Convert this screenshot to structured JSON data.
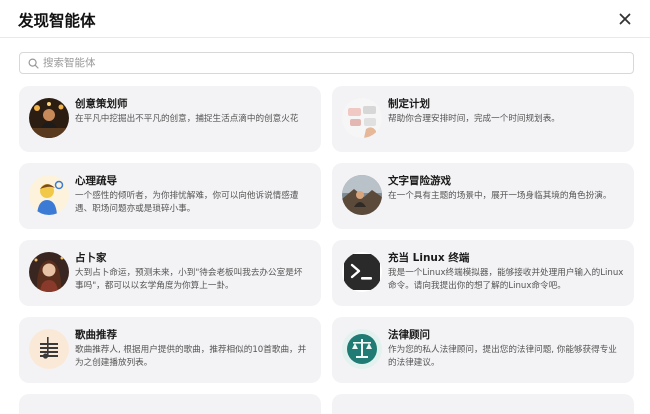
{
  "header": {
    "title": "发现智能体"
  },
  "search": {
    "placeholder": "搜索智能体"
  },
  "cards": [
    {
      "name": "创意策划师",
      "desc1": "在平凡中挖掘出不平凡的创意，捕捉生活点滴中的创意火花",
      "desc2": ""
    },
    {
      "name": "制定计划",
      "desc1": "帮助你合理安排时间，完成一个时间规划表。",
      "desc2": ""
    },
    {
      "name": "心理疏导",
      "desc1": "一个感性的倾听者，为你排忧解难，你可以向他诉说情感遭",
      "desc2": "遇、职场问题亦或是琐碎小事。"
    },
    {
      "name": "文字冒险游戏",
      "desc1": "在一个具有主题的场景中，展开一场身临其境的角色扮演。",
      "desc2": ""
    },
    {
      "name": "占卜家",
      "desc1": "大到占卜命运，预测未来，小到\"待会老板叫我去办公室是坏",
      "desc2": "事吗\"，都可以以玄学角度为你算上一卦。"
    },
    {
      "name": "充当 Linux 终端",
      "desc1": "我是一个Linux终端模拟器，能够接收并处理用户输入的Linux",
      "desc2": "命令。请向我提出你的想了解的Linux命令吧。"
    },
    {
      "name": "歌曲推荐",
      "desc1": "歌曲推荐人, 根据用户提供的歌曲，推荐相似的10首歌曲，并",
      "desc2": "为之创建播放列表。"
    },
    {
      "name": "法律顾问",
      "desc1": "作为您的私人法律顾问，提出您的法律问题, 你能够获得专业",
      "desc2": "的法律建议。"
    }
  ]
}
